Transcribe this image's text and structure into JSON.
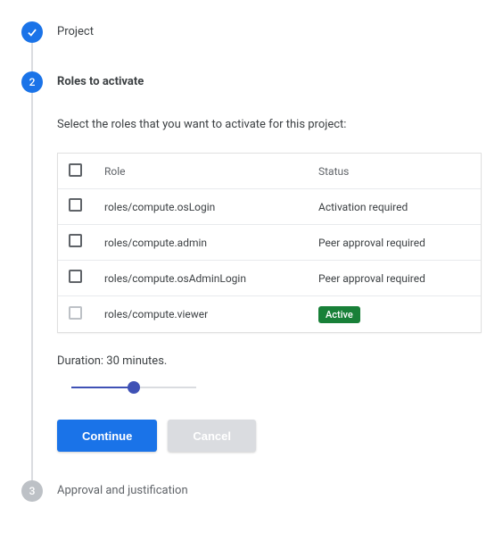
{
  "steps": {
    "step1": {
      "title": "Project"
    },
    "step2": {
      "number": "2",
      "title": "Roles to activate",
      "instruction": "Select the roles that you want to activate for this project:"
    },
    "step3": {
      "number": "3",
      "title": "Approval and justification"
    }
  },
  "table": {
    "headers": {
      "role": "Role",
      "status": "Status"
    },
    "rows": [
      {
        "role": "roles/compute.osLogin",
        "status": "Activation required",
        "badge": false,
        "disabled": false
      },
      {
        "role": "roles/compute.admin",
        "status": "Peer approval required",
        "badge": false,
        "disabled": false
      },
      {
        "role": "roles/compute.osAdminLogin",
        "status": "Peer approval required",
        "badge": false,
        "disabled": false
      },
      {
        "role": "roles/compute.viewer",
        "status": "Active",
        "badge": true,
        "disabled": true
      }
    ]
  },
  "duration": {
    "label": "Duration: 30 minutes."
  },
  "buttons": {
    "continue": "Continue",
    "cancel": "Cancel"
  },
  "colors": {
    "primary": "#1a73e8",
    "slider": "#3f51b5",
    "badge": "#188038"
  }
}
